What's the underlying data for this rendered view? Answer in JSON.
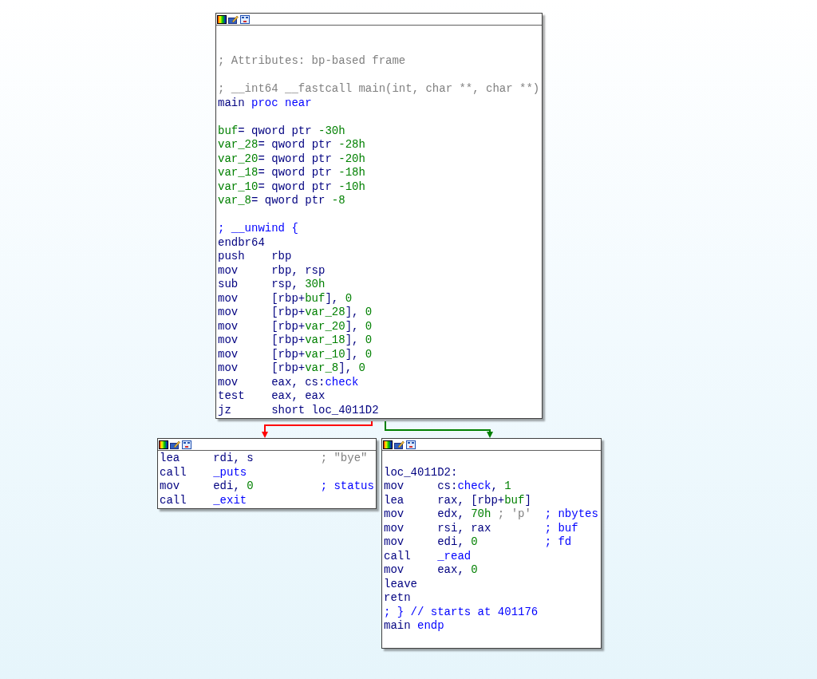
{
  "nodes": [
    {
      "lines": [
        {
          "kind": "blank"
        },
        {
          "kind": "blank"
        },
        {
          "kind": "text",
          "tokens": [
            {
              "t": "; Attributes: bp-based frame",
              "kind": "comment"
            }
          ]
        },
        {
          "kind": "blank"
        },
        {
          "kind": "text",
          "tokens": [
            {
              "t": "; __int64 __fastcall main(int, char **, char **)",
              "kind": "comment"
            }
          ]
        },
        {
          "kind": "text",
          "tokens": [
            {
              "t": "main",
              "kind": "code"
            },
            {
              "t": " proc near",
              "kind": "name"
            }
          ]
        },
        {
          "kind": "blank"
        },
        {
          "kind": "text",
          "tokens": [
            {
              "t": "buf",
              "kind": "number"
            },
            {
              "t": "= qword ptr ",
              "kind": "code"
            },
            {
              "t": "-30h",
              "kind": "number"
            }
          ]
        },
        {
          "kind": "text",
          "tokens": [
            {
              "t": "var_28",
              "kind": "number"
            },
            {
              "t": "= qword ptr ",
              "kind": "code"
            },
            {
              "t": "-28h",
              "kind": "number"
            }
          ]
        },
        {
          "kind": "text",
          "tokens": [
            {
              "t": "var_20",
              "kind": "number"
            },
            {
              "t": "= qword ptr ",
              "kind": "code"
            },
            {
              "t": "-20h",
              "kind": "number"
            }
          ]
        },
        {
          "kind": "text",
          "tokens": [
            {
              "t": "var_18",
              "kind": "number"
            },
            {
              "t": "= qword ptr ",
              "kind": "code"
            },
            {
              "t": "-18h",
              "kind": "number"
            }
          ]
        },
        {
          "kind": "text",
          "tokens": [
            {
              "t": "var_10",
              "kind": "number"
            },
            {
              "t": "= qword ptr ",
              "kind": "code"
            },
            {
              "t": "-10h",
              "kind": "number"
            }
          ]
        },
        {
          "kind": "text",
          "tokens": [
            {
              "t": "var_8",
              "kind": "number"
            },
            {
              "t": "= qword ptr ",
              "kind": "code"
            },
            {
              "t": "-8",
              "kind": "number"
            }
          ]
        },
        {
          "kind": "blank"
        },
        {
          "kind": "text",
          "tokens": [
            {
              "t": "; __unwind {",
              "kind": "name"
            }
          ]
        },
        {
          "kind": "text",
          "tokens": [
            {
              "t": "endbr64",
              "kind": "code"
            }
          ]
        },
        {
          "kind": "instr",
          "op": "push",
          "args": [
            {
              "t": "rbp",
              "kind": "code"
            }
          ]
        },
        {
          "kind": "instr",
          "op": "mov",
          "args": [
            {
              "t": "rbp, rsp",
              "kind": "code"
            }
          ]
        },
        {
          "kind": "instr",
          "op": "sub",
          "args": [
            {
              "t": "rsp, ",
              "kind": "code"
            },
            {
              "t": "30h",
              "kind": "number"
            }
          ]
        },
        {
          "kind": "instr",
          "op": "mov",
          "args": [
            {
              "t": "[rbp+",
              "kind": "code"
            },
            {
              "t": "buf",
              "kind": "number"
            },
            {
              "t": "], ",
              "kind": "code"
            },
            {
              "t": "0",
              "kind": "number"
            }
          ]
        },
        {
          "kind": "instr",
          "op": "mov",
          "args": [
            {
              "t": "[rbp+",
              "kind": "code"
            },
            {
              "t": "var_28",
              "kind": "number"
            },
            {
              "t": "], ",
              "kind": "code"
            },
            {
              "t": "0",
              "kind": "number"
            }
          ]
        },
        {
          "kind": "instr",
          "op": "mov",
          "args": [
            {
              "t": "[rbp+",
              "kind": "code"
            },
            {
              "t": "var_20",
              "kind": "number"
            },
            {
              "t": "], ",
              "kind": "code"
            },
            {
              "t": "0",
              "kind": "number"
            }
          ]
        },
        {
          "kind": "instr",
          "op": "mov",
          "args": [
            {
              "t": "[rbp+",
              "kind": "code"
            },
            {
              "t": "var_18",
              "kind": "number"
            },
            {
              "t": "], ",
              "kind": "code"
            },
            {
              "t": "0",
              "kind": "number"
            }
          ]
        },
        {
          "kind": "instr",
          "op": "mov",
          "args": [
            {
              "t": "[rbp+",
              "kind": "code"
            },
            {
              "t": "var_10",
              "kind": "number"
            },
            {
              "t": "], ",
              "kind": "code"
            },
            {
              "t": "0",
              "kind": "number"
            }
          ]
        },
        {
          "kind": "instr",
          "op": "mov",
          "args": [
            {
              "t": "[rbp+",
              "kind": "code"
            },
            {
              "t": "var_8",
              "kind": "number"
            },
            {
              "t": "], ",
              "kind": "code"
            },
            {
              "t": "0",
              "kind": "number"
            }
          ]
        },
        {
          "kind": "instr",
          "op": "mov",
          "args": [
            {
              "t": "eax, cs:",
              "kind": "code"
            },
            {
              "t": "check",
              "kind": "name"
            }
          ]
        },
        {
          "kind": "instr",
          "op": "test",
          "args": [
            {
              "t": "eax, eax",
              "kind": "code"
            }
          ]
        },
        {
          "kind": "instr",
          "op": "jz",
          "args": [
            {
              "t": "short loc_4011D2",
              "kind": "code"
            }
          ]
        }
      ]
    },
    {
      "lines": [
        {
          "kind": "instr",
          "op": "lea",
          "args": [
            {
              "t": "rdi, s",
              "kind": "code"
            }
          ],
          "comment": [
            {
              "t": "; \"bye\"",
              "kind": "comment"
            }
          ]
        },
        {
          "kind": "instr",
          "op": "call",
          "args": [
            {
              "t": "_puts",
              "kind": "name"
            }
          ]
        },
        {
          "kind": "instr",
          "op": "mov",
          "args": [
            {
              "t": "edi, ",
              "kind": "code"
            },
            {
              "t": "0",
              "kind": "number"
            }
          ],
          "comment": [
            {
              "t": "; status",
              "kind": "name"
            }
          ]
        },
        {
          "kind": "instr",
          "op": "call",
          "args": [
            {
              "t": "_exit",
              "kind": "name"
            }
          ]
        }
      ]
    },
    {
      "lines": [
        {
          "kind": "blank"
        },
        {
          "kind": "text",
          "tokens": [
            {
              "t": "loc_4011D2:",
              "kind": "code"
            }
          ]
        },
        {
          "kind": "instr",
          "op": "mov",
          "args": [
            {
              "t": "cs:",
              "kind": "code"
            },
            {
              "t": "check",
              "kind": "name"
            },
            {
              "t": ", ",
              "kind": "code"
            },
            {
              "t": "1",
              "kind": "number"
            }
          ]
        },
        {
          "kind": "instr",
          "op": "lea",
          "args": [
            {
              "t": "rax, [rbp+",
              "kind": "code"
            },
            {
              "t": "buf",
              "kind": "number"
            },
            {
              "t": "]",
              "kind": "code"
            }
          ]
        },
        {
          "kind": "instr",
          "op": "mov",
          "args": [
            {
              "t": "edx, ",
              "kind": "code"
            },
            {
              "t": "70h",
              "kind": "number"
            },
            {
              "t": " ; 'p'",
              "kind": "comment"
            }
          ],
          "comment": [
            {
              "t": "; nbytes",
              "kind": "name"
            }
          ]
        },
        {
          "kind": "instr",
          "op": "mov",
          "args": [
            {
              "t": "rsi, rax",
              "kind": "code"
            }
          ],
          "comment": [
            {
              "t": "; buf",
              "kind": "name"
            }
          ]
        },
        {
          "kind": "instr",
          "op": "mov",
          "args": [
            {
              "t": "edi, ",
              "kind": "code"
            },
            {
              "t": "0",
              "kind": "number"
            }
          ],
          "comment": [
            {
              "t": "; fd",
              "kind": "name"
            }
          ]
        },
        {
          "kind": "instr",
          "op": "call",
          "args": [
            {
              "t": "_read",
              "kind": "name"
            }
          ]
        },
        {
          "kind": "instr",
          "op": "mov",
          "args": [
            {
              "t": "eax, ",
              "kind": "code"
            },
            {
              "t": "0",
              "kind": "number"
            }
          ]
        },
        {
          "kind": "text",
          "tokens": [
            {
              "t": "leave",
              "kind": "code"
            }
          ]
        },
        {
          "kind": "text",
          "tokens": [
            {
              "t": "retn",
              "kind": "code"
            }
          ]
        },
        {
          "kind": "text",
          "tokens": [
            {
              "t": "; } // starts at 401176",
              "kind": "name"
            }
          ]
        },
        {
          "kind": "text",
          "tokens": [
            {
              "t": "main",
              "kind": "code"
            },
            {
              "t": " endp",
              "kind": "name"
            }
          ]
        },
        {
          "kind": "blank"
        }
      ]
    }
  ],
  "edges": [
    {
      "color": "#ff0000"
    },
    {
      "color": "#008000"
    }
  ]
}
